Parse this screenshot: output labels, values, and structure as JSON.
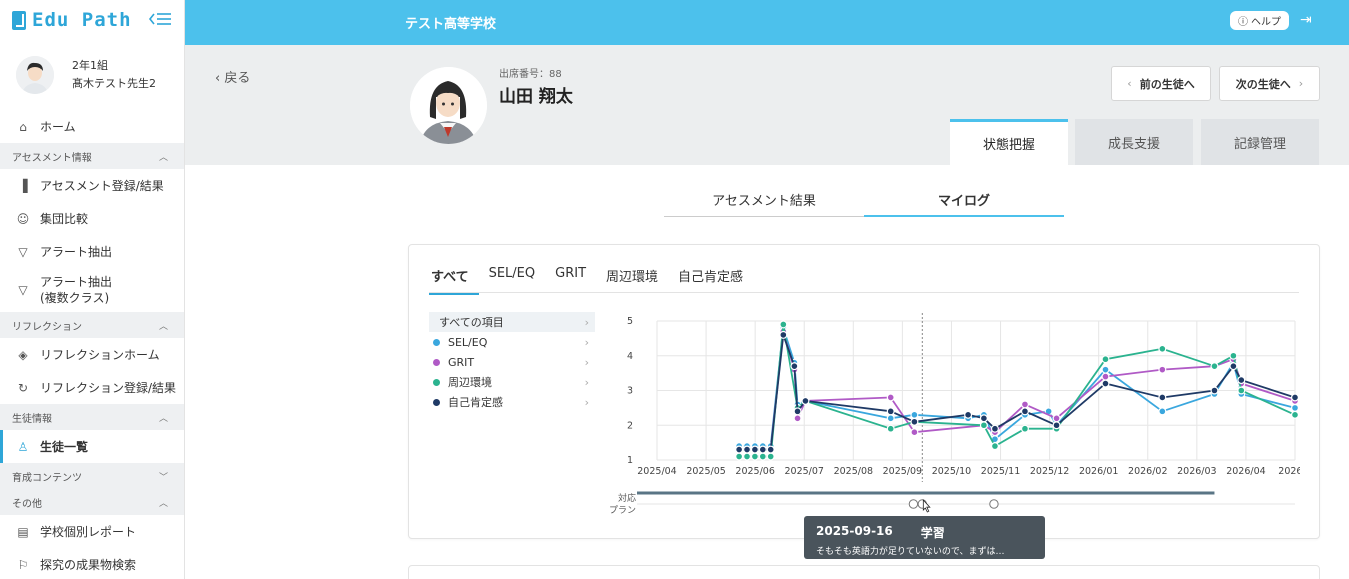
{
  "app": {
    "logo_text": "Edu Path",
    "school_name": "テスト高等学校",
    "help_label": "ヘルプ"
  },
  "user": {
    "class": "2年1組",
    "teacher": "髙木テスト先生2"
  },
  "sidebar": {
    "home": "ホーム",
    "section_assessment": "アセスメント情報",
    "assessment_items": [
      "アセスメント登録/結果",
      "集団比較",
      "アラート抽出"
    ],
    "alert_multi_line1": "アラート抽出",
    "alert_multi_line2": "(複数クラス)",
    "section_reflection": "リフレクション",
    "reflection_items": [
      "リフレクションホーム",
      "リフレクション登録/結果"
    ],
    "section_student": "生徒情報",
    "student_list": "生徒一覧",
    "section_growth": "育成コンテンツ",
    "section_other": "その他",
    "other_items": [
      "学校個別レポート",
      "探究の成果物検索"
    ]
  },
  "student": {
    "back_label": "戻る",
    "seat_number": "出席番号：88",
    "name": "山田 翔太"
  },
  "buttons": {
    "prev_student": "前の生徒へ",
    "next_student": "次の生徒へ"
  },
  "main_tabs": [
    "状態把握",
    "成長支援",
    "記録管理"
  ],
  "sub_tabs": [
    "アセスメント結果",
    "マイログ"
  ],
  "category_tabs": [
    "すべて",
    "SEL/EQ",
    "GRIT",
    "周辺環境",
    "自己肯定感"
  ],
  "legend": {
    "all": "すべての項目",
    "items": [
      {
        "label": "SEL/EQ",
        "color": "#3aa7de"
      },
      {
        "label": "GRIT",
        "color": "#b05ac6"
      },
      {
        "label": "周辺環境",
        "color": "#2bb38f"
      },
      {
        "label": "自己肯定感",
        "color": "#1f3a66"
      }
    ]
  },
  "chart_data": {
    "type": "line",
    "x_ticks": [
      "2025/04",
      "2025/05",
      "2025/06",
      "2025/07",
      "2025/08",
      "2025/09",
      "2025/10",
      "2025/11",
      "2025/12",
      "2026/01",
      "2026/02",
      "2026/03",
      "2026/04",
      "2026/0"
    ],
    "ylim": [
      1,
      5
    ],
    "y_ticks": [
      "1",
      "2",
      "3",
      "4",
      "5"
    ],
    "plan_label_line1": "対応",
    "plan_label_line2": "プラン",
    "x_range": [
      "2025-04-01",
      "2026-05-10"
    ],
    "marker_date": "2025-09-16",
    "plan_dates": [
      "2025-09-11",
      "2025-09-16",
      "2025-11-01"
    ],
    "plan_bar_end": "2026-03-20",
    "series": [
      {
        "name": "SEL/EQ",
        "color": "#3aa7de",
        "points": [
          [
            "2025-05-23",
            1.4
          ],
          [
            "2025-05-28",
            1.4
          ],
          [
            "2025-06-02",
            1.4
          ],
          [
            "2025-06-07",
            1.4
          ],
          [
            "2025-06-12",
            1.4
          ],
          [
            "2025-06-20",
            4.8
          ],
          [
            "2025-06-27",
            3.8
          ],
          [
            "2025-06-29",
            2.6
          ],
          [
            "2025-07-04",
            2.7
          ],
          [
            "2025-08-27",
            2.2
          ],
          [
            "2025-09-11",
            2.3
          ],
          [
            "2025-10-15",
            2.2
          ],
          [
            "2025-10-25",
            2.3
          ],
          [
            "2025-11-01",
            1.6
          ],
          [
            "2025-11-20",
            2.3
          ],
          [
            "2025-12-05",
            2.4
          ],
          [
            "2025-12-10",
            2.0
          ],
          [
            "2026-01-10",
            3.6
          ],
          [
            "2026-02-15",
            2.4
          ],
          [
            "2026-03-20",
            2.9
          ],
          [
            "2026-04-01",
            3.8
          ],
          [
            "2026-04-06",
            2.9
          ],
          [
            "2026-05-10",
            2.5
          ]
        ]
      },
      {
        "name": "GRIT",
        "color": "#b05ac6",
        "points": [
          [
            "2025-05-23",
            1.3
          ],
          [
            "2025-05-28",
            1.3
          ],
          [
            "2025-06-02",
            1.3
          ],
          [
            "2025-06-07",
            1.3
          ],
          [
            "2025-06-12",
            1.3
          ],
          [
            "2025-06-20",
            4.7
          ],
          [
            "2025-06-27",
            3.6
          ],
          [
            "2025-06-29",
            2.2
          ],
          [
            "2025-07-04",
            2.7
          ],
          [
            "2025-08-27",
            2.8
          ],
          [
            "2025-09-11",
            1.8
          ],
          [
            "2025-10-25",
            2.0
          ],
          [
            "2025-11-01",
            1.8
          ],
          [
            "2025-11-20",
            2.6
          ],
          [
            "2025-12-10",
            2.2
          ],
          [
            "2026-01-10",
            3.4
          ],
          [
            "2026-02-15",
            3.6
          ],
          [
            "2026-03-20",
            3.7
          ],
          [
            "2026-04-01",
            3.9
          ],
          [
            "2026-04-06",
            3.2
          ],
          [
            "2026-05-10",
            2.7
          ]
        ]
      },
      {
        "name": "周辺環境",
        "color": "#2bb38f",
        "points": [
          [
            "2025-05-23",
            1.1
          ],
          [
            "2025-05-28",
            1.1
          ],
          [
            "2025-06-02",
            1.1
          ],
          [
            "2025-06-07",
            1.1
          ],
          [
            "2025-06-12",
            1.1
          ],
          [
            "2025-06-20",
            4.9
          ],
          [
            "2025-06-29",
            2.5
          ],
          [
            "2025-07-04",
            2.7
          ],
          [
            "2025-08-27",
            1.9
          ],
          [
            "2025-09-11",
            2.1
          ],
          [
            "2025-10-25",
            2.0
          ],
          [
            "2025-11-01",
            1.4
          ],
          [
            "2025-11-20",
            1.9
          ],
          [
            "2025-12-10",
            1.9
          ],
          [
            "2026-01-10",
            3.9
          ],
          [
            "2026-02-15",
            4.2
          ],
          [
            "2026-03-20",
            3.7
          ],
          [
            "2026-04-01",
            4.0
          ],
          [
            "2026-04-06",
            3.0
          ],
          [
            "2026-05-10",
            2.3
          ]
        ]
      },
      {
        "name": "自己肯定感",
        "color": "#1f3a66",
        "points": [
          [
            "2025-05-23",
            1.3
          ],
          [
            "2025-05-28",
            1.3
          ],
          [
            "2025-06-02",
            1.3
          ],
          [
            "2025-06-07",
            1.3
          ],
          [
            "2025-06-12",
            1.3
          ],
          [
            "2025-06-20",
            4.6
          ],
          [
            "2025-06-27",
            3.7
          ],
          [
            "2025-06-29",
            2.4
          ],
          [
            "2025-07-04",
            2.7
          ],
          [
            "2025-08-27",
            2.4
          ],
          [
            "2025-09-11",
            2.1
          ],
          [
            "2025-10-15",
            2.3
          ],
          [
            "2025-10-25",
            2.2
          ],
          [
            "2025-11-01",
            1.9
          ],
          [
            "2025-11-20",
            2.4
          ],
          [
            "2025-12-10",
            2.0
          ],
          [
            "2026-01-10",
            3.2
          ],
          [
            "2026-02-15",
            2.8
          ],
          [
            "2026-03-20",
            3.0
          ],
          [
            "2026-04-01",
            3.7
          ],
          [
            "2026-04-06",
            3.3
          ],
          [
            "2026-05-10",
            2.8
          ]
        ]
      }
    ]
  },
  "tooltip": {
    "date": "2025-09-16",
    "category": "学習",
    "text": "そもそも英語力が足りていないので、まずは…"
  }
}
